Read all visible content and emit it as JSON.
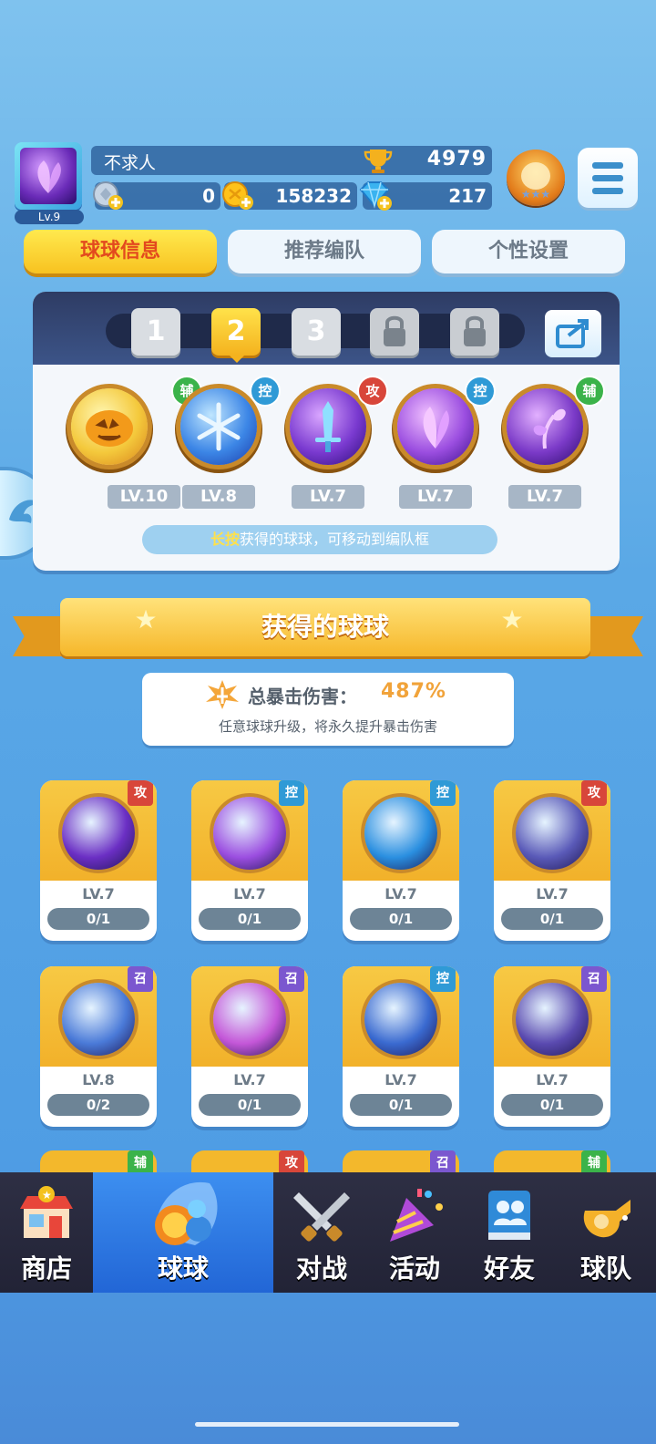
{
  "player": {
    "name": "不求人",
    "level": "Lv.9",
    "trophies": "4979"
  },
  "resources": {
    "stamina": "0",
    "coins": "158232",
    "gems": "217"
  },
  "tabs": [
    {
      "label": "球球信息",
      "active": true
    },
    {
      "label": "推荐编队",
      "active": false
    },
    {
      "label": "个性设置",
      "active": false
    }
  ],
  "team_slots": [
    {
      "label": "1",
      "state": "normal"
    },
    {
      "label": "2",
      "state": "selected"
    },
    {
      "label": "3",
      "state": "normal"
    },
    {
      "label": "",
      "state": "locked"
    },
    {
      "label": "",
      "state": "locked"
    }
  ],
  "team": [
    {
      "role": "辅",
      "level": "LV.10",
      "icon": "pumpkin-ball-icon",
      "color": "#f4c93c"
    },
    {
      "role": "控",
      "level": "LV.8",
      "icon": "snowflake-ball-icon",
      "color": "#3c86e6"
    },
    {
      "role": "攻",
      "level": "LV.7",
      "icon": "sword-ball-icon",
      "color": "#7a3ad0"
    },
    {
      "role": "控",
      "level": "LV.7",
      "icon": "butterfly-ball-icon",
      "color": "#9b4ee0"
    },
    {
      "role": "辅",
      "level": "LV.7",
      "icon": "sprout-ball-icon",
      "color": "#7b3ac8"
    }
  ],
  "hint": {
    "highlight": "长按",
    "text": "获得的球球，可移动到编队框"
  },
  "owned_section": {
    "title": "获得的球球"
  },
  "crit": {
    "label": "总暴击伤害：",
    "value": "487%",
    "desc": "任意球球升级，将永久提升暴击伤害"
  },
  "cards": [
    {
      "role": "攻",
      "level": "LV.7",
      "progress": "0/1",
      "icon": "sword-ball-icon",
      "color": "#6b2fc4"
    },
    {
      "role": "控",
      "level": "LV.7",
      "progress": "0/1",
      "icon": "butterfly-ball-icon",
      "color": "#9b4ee0"
    },
    {
      "role": "控",
      "level": "LV.7",
      "progress": "0/1",
      "icon": "wave-ball-icon",
      "color": "#2a8fe0"
    },
    {
      "role": "攻",
      "level": "LV.7",
      "progress": "0/1",
      "icon": "block-ball-icon",
      "color": "#5a5ab8"
    },
    {
      "role": "召",
      "level": "LV.8",
      "progress": "0/2",
      "icon": "tornado-ball-icon",
      "color": "#4a7ad8"
    },
    {
      "role": "召",
      "level": "LV.7",
      "progress": "0/1",
      "icon": "mushroom-ball-icon",
      "color": "#c457d8"
    },
    {
      "role": "控",
      "level": "LV.7",
      "progress": "0/1",
      "icon": "clock-ball-icon",
      "color": "#3a6ad0"
    },
    {
      "role": "召",
      "level": "LV.7",
      "progress": "0/1",
      "icon": "ghost-ball-icon",
      "color": "#5a4ab0"
    }
  ],
  "peek_roles": [
    "辅",
    "攻",
    "召",
    "辅"
  ],
  "nav": [
    {
      "label": "商店",
      "icon": "shop-icon",
      "active": false
    },
    {
      "label": "球球",
      "icon": "balls-icon",
      "active": true
    },
    {
      "label": "对战",
      "icon": "swords-icon",
      "active": false
    },
    {
      "label": "活动",
      "icon": "party-popper-icon",
      "active": false
    },
    {
      "label": "好友",
      "icon": "friends-book-icon",
      "active": false
    },
    {
      "label": "球队",
      "icon": "whistle-icon",
      "active": false
    }
  ]
}
